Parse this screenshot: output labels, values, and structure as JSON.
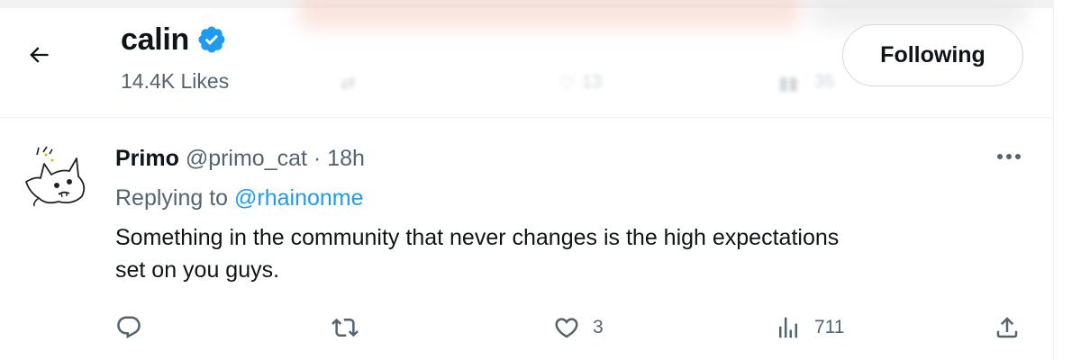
{
  "header": {
    "back_icon": "arrow-left-icon",
    "profile_name": "calin",
    "verified_icon": "verified-badge-icon",
    "likes_count": "14.4K Likes",
    "follow_button_label": "Following"
  },
  "background_peek": {
    "like_count": "13",
    "views_count": "35"
  },
  "tweet": {
    "author_name": "Primo",
    "author_handle": "@primo_cat",
    "separator": "·",
    "timestamp": "18h",
    "more_icon": "more-dots-icon",
    "replying_to_label": "Replying to",
    "replying_to_handle": "@rhainonme",
    "text_line_1": "Something in the community that never changes is the high expectations",
    "text_line_2": "set on you guys.",
    "actions": {
      "reply_icon": "reply-icon",
      "retweet_icon": "retweet-icon",
      "like_icon": "heart-icon",
      "like_count": "3",
      "views_icon": "views-chart-icon",
      "views_count": "711",
      "share_icon": "share-icon"
    }
  },
  "colors": {
    "accent": "#1d9bf0",
    "text_primary": "#0f1419",
    "text_secondary": "#536471",
    "border": "#eff3f4",
    "button_border": "#cfd9de"
  }
}
